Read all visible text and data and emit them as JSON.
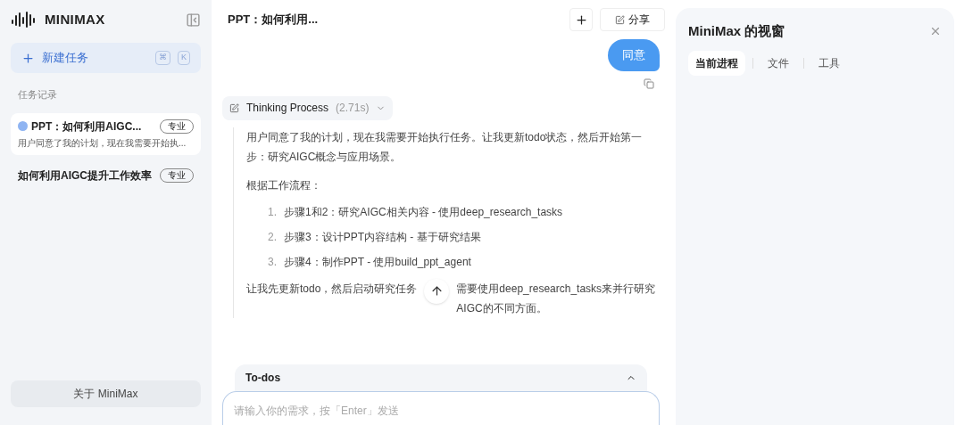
{
  "sidebar": {
    "logo": "MINIMAX",
    "new_task": {
      "label": "新建任务",
      "keys": [
        "⌘",
        "K"
      ]
    },
    "section_title": "任务记录",
    "tasks": [
      {
        "title": "PPT：如何利用AIGC...",
        "badge": "专业",
        "preview": "用户同意了我的计划，现在我需要开始执...",
        "selected": true,
        "running": true
      },
      {
        "title": "如何利用AIGC提升工作效率",
        "badge": "专业",
        "selected": false,
        "running": false
      }
    ],
    "about": "关于 MiniMax"
  },
  "chat": {
    "title": "PPT：如何利用...",
    "share": "分享",
    "user_message": "同意",
    "thinking": {
      "label": "Thinking Process",
      "time": "(2.71s)",
      "expanded": true,
      "blocks": [
        {
          "kind": "para",
          "text": "用户同意了我的计划，现在我需要开始执行任务。让我更新todo状态，然后开始第一步：研究AIGC概念与应用场景。"
        },
        {
          "kind": "para",
          "text": "根据工作流程："
        },
        {
          "kind": "list",
          "items": [
            {
              "number": "1.",
              "text": "步骤1和2：研究AIGC相关内容 - 使用deep_research_tasks"
            },
            {
              "number": "2.",
              "text": "步骤3：设计PPT内容结构 - 基于研究结果"
            },
            {
              "number": "3.",
              "text": "步骤4：制作PPT - 使用build_ppt_agent"
            }
          ]
        },
        {
          "kind": "split",
          "before": "让我先更新todo，然后启动研究任务",
          "after": "需要使用deep_research_tasks来并行研究AIGC的不同方面。"
        }
      ]
    },
    "todos": {
      "label": "To-dos",
      "expanded": true
    },
    "input": {
      "placeholder": "请输入你的需求，按「Enter」发送"
    }
  },
  "panel": {
    "title": "MiniMax 的视窗",
    "tabs": [
      {
        "label": "当前进程",
        "selected": true
      },
      {
        "label": "文件",
        "selected": false
      },
      {
        "label": "工具",
        "selected": false
      }
    ]
  }
}
